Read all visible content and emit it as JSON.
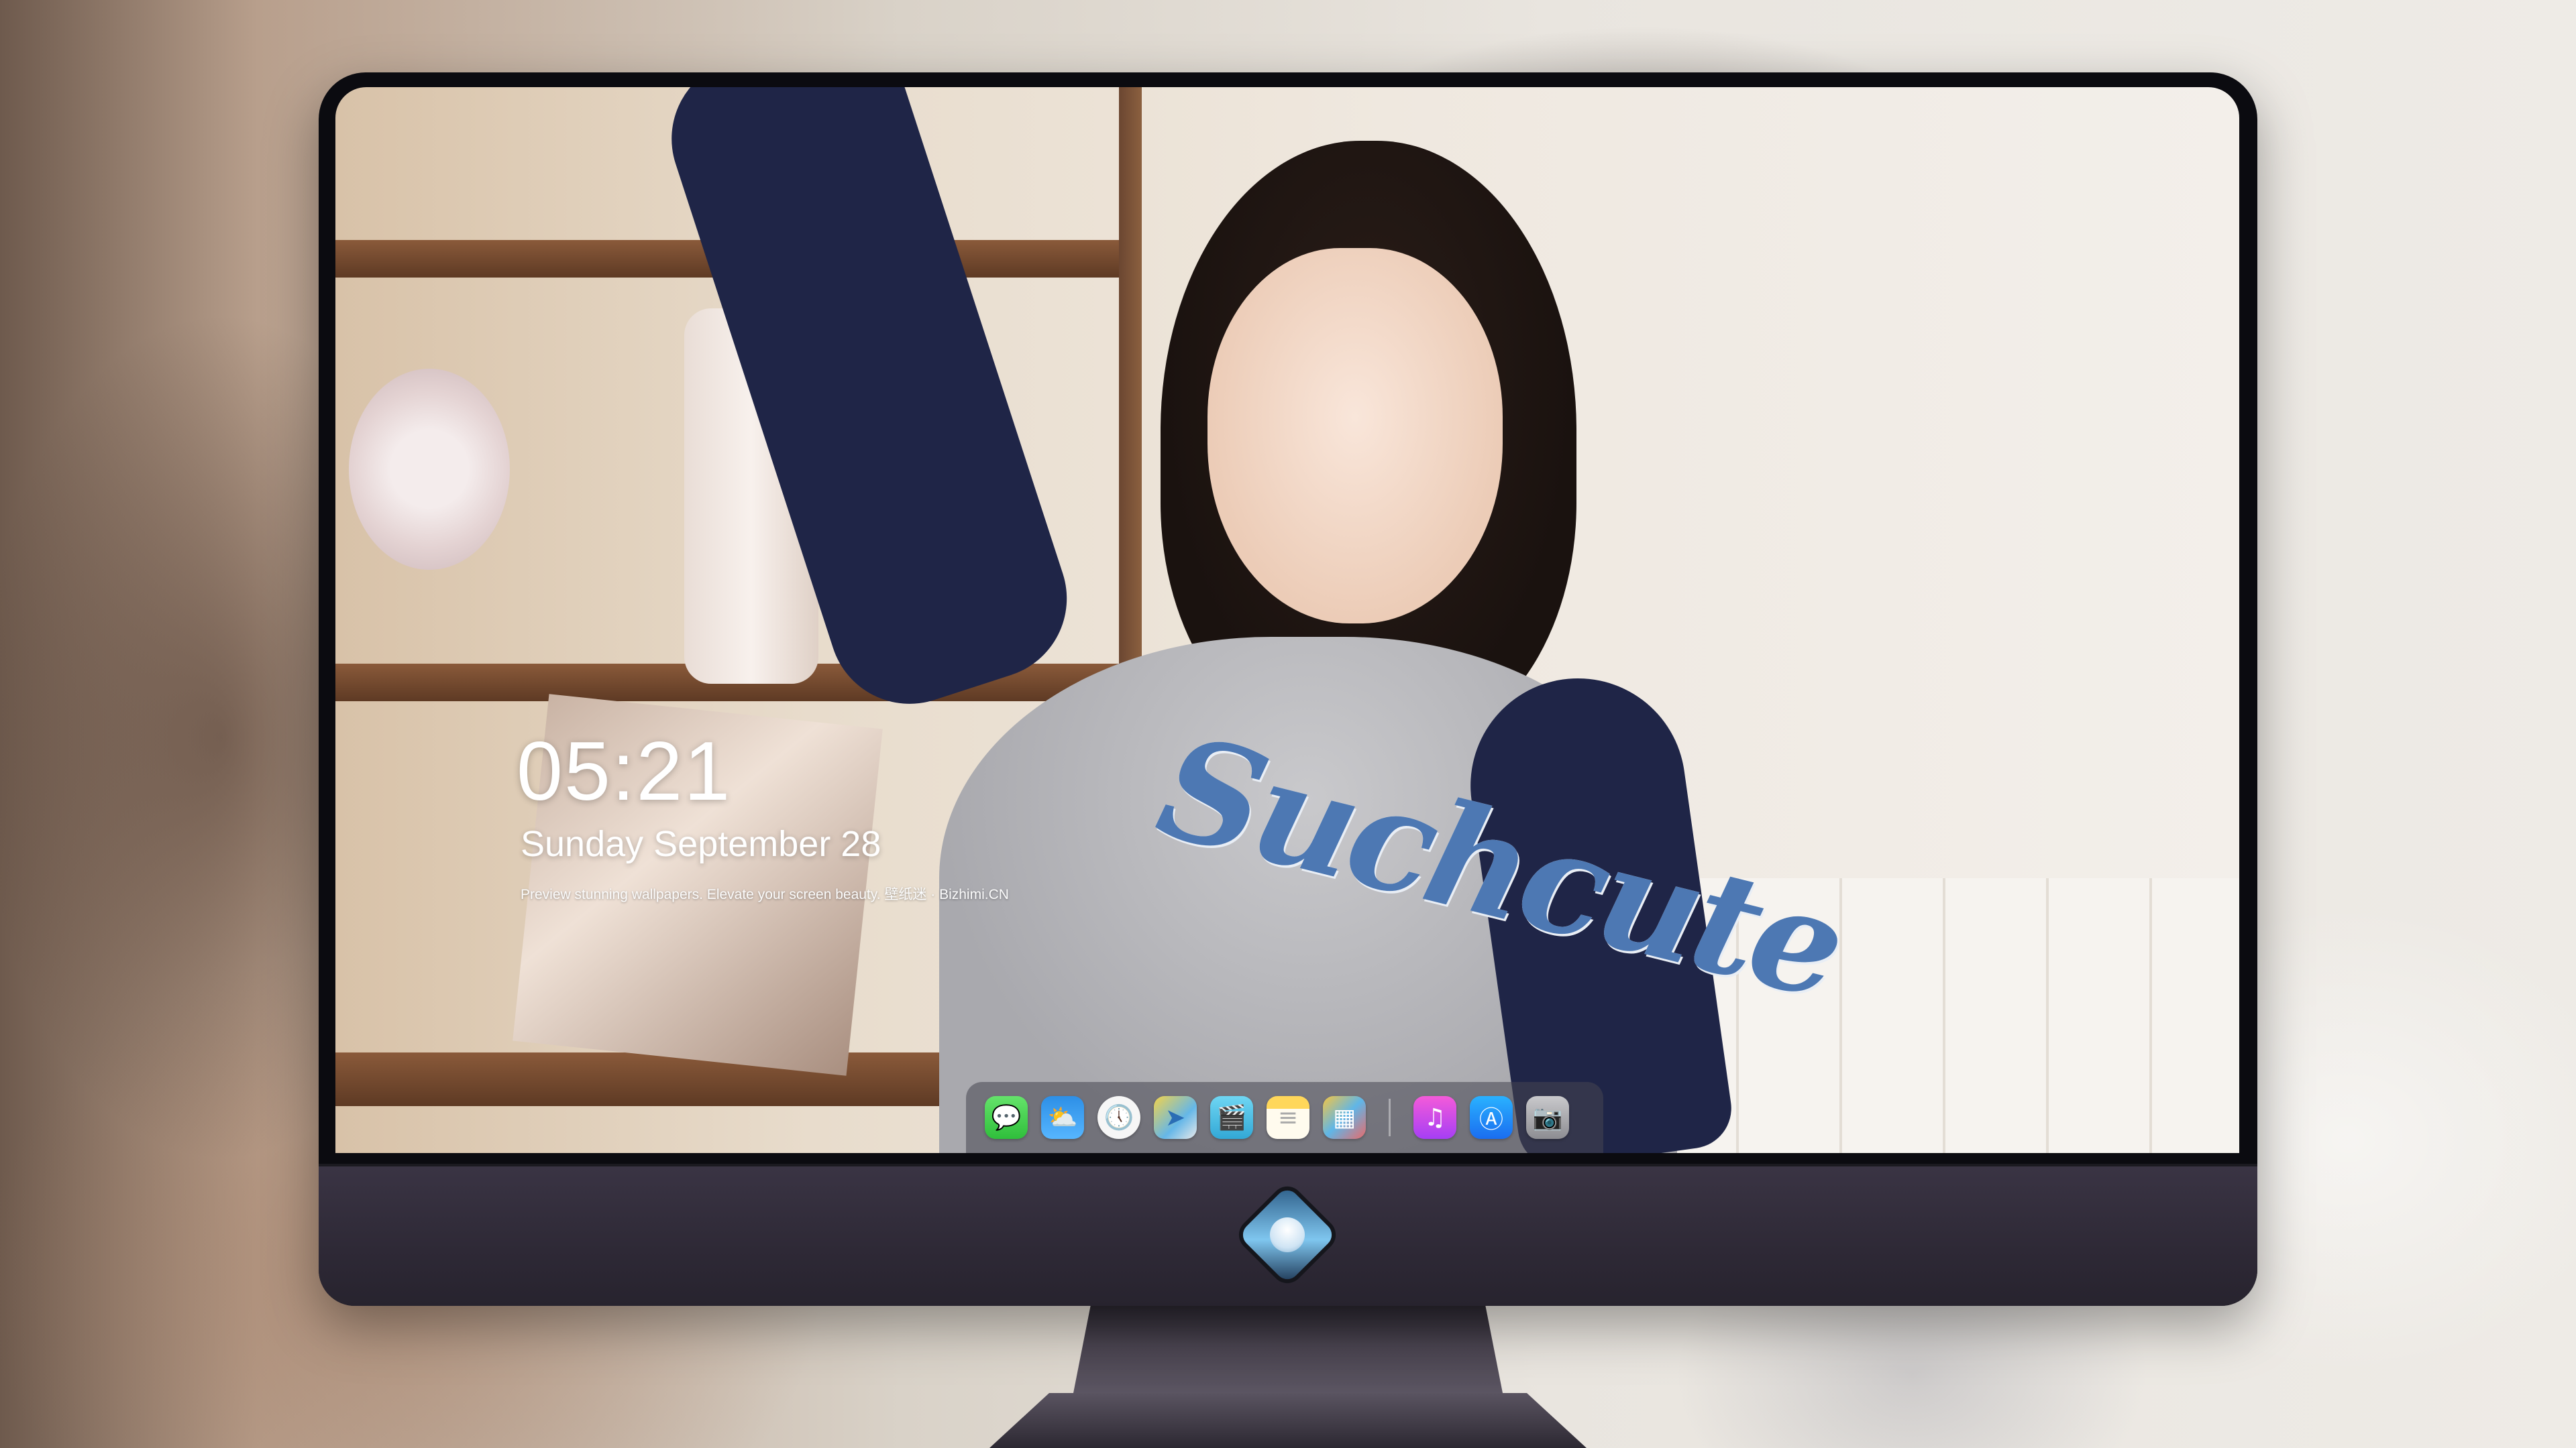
{
  "lockscreen": {
    "time": "05:21",
    "date": "Sunday September  28",
    "tagline": "Preview stunning wallpapers. Elevate your screen beauty. 壁纸迷 · Bizhimi.CN"
  },
  "wallpaper": {
    "shirt_print": "Suchcute"
  },
  "dock": {
    "apps": [
      {
        "name": "Messages",
        "icon": "message-bubble-icon",
        "glyph": "💬"
      },
      {
        "name": "Weather",
        "icon": "cloud-sun-icon",
        "glyph": "⛅"
      },
      {
        "name": "Clock",
        "icon": "clock-icon",
        "glyph": "🕔"
      },
      {
        "name": "Maps",
        "icon": "map-icon",
        "glyph": "➤"
      },
      {
        "name": "Videos",
        "icon": "clapperboard-icon",
        "glyph": "🎬"
      },
      {
        "name": "Notes",
        "icon": "notes-icon",
        "glyph": "≡"
      },
      {
        "name": "Photos",
        "icon": "photos-icon",
        "glyph": "▦"
      },
      {
        "name": "Music",
        "icon": "music-note-icon",
        "glyph": "♫"
      },
      {
        "name": "App Store",
        "icon": "app-store-icon",
        "glyph": "Ⓐ"
      },
      {
        "name": "Camera",
        "icon": "camera-icon",
        "glyph": "📷"
      }
    ]
  },
  "colors": {
    "bezel": "#0b0b10",
    "chin": "#2e2936",
    "dock_bg": "#46464f",
    "shirt_text": "#4d78b3"
  }
}
